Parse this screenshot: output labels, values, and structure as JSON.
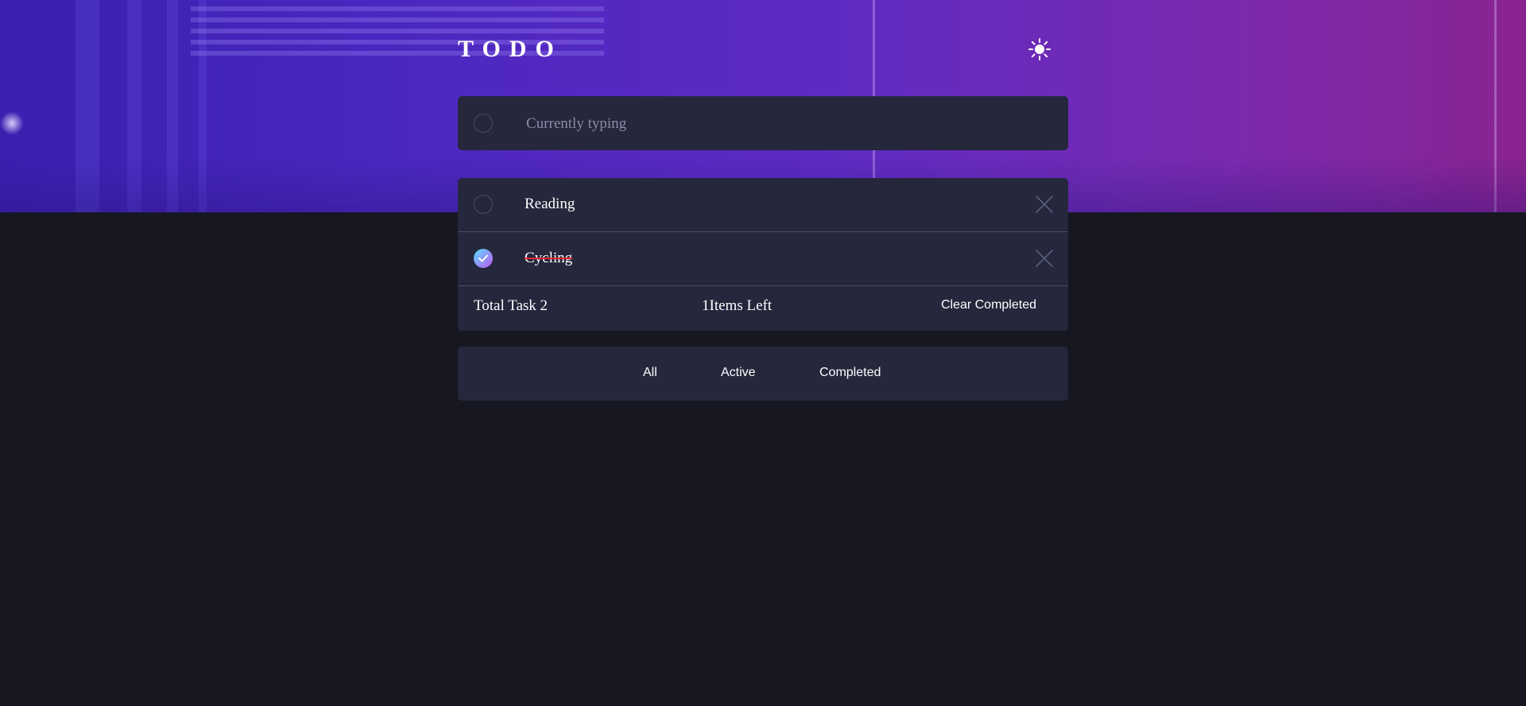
{
  "header": {
    "title": "TODO",
    "theme_icon": "sun-icon"
  },
  "new_todo": {
    "placeholder": "Currently typing"
  },
  "todos": [
    {
      "label": "Reading",
      "completed": false
    },
    {
      "label": "Cycling",
      "completed": true
    }
  ],
  "footer": {
    "total": "Total Task 2",
    "items_left": "1Items Left",
    "clear_label": "Clear Completed"
  },
  "filters": {
    "all": "All",
    "active": "Active",
    "completed": "Completed"
  },
  "colors": {
    "background": "#171722",
    "card": "#25273c",
    "check_gradient_start": "#57ddff",
    "check_gradient_end": "#c058f3",
    "strike": "#e0262f"
  }
}
